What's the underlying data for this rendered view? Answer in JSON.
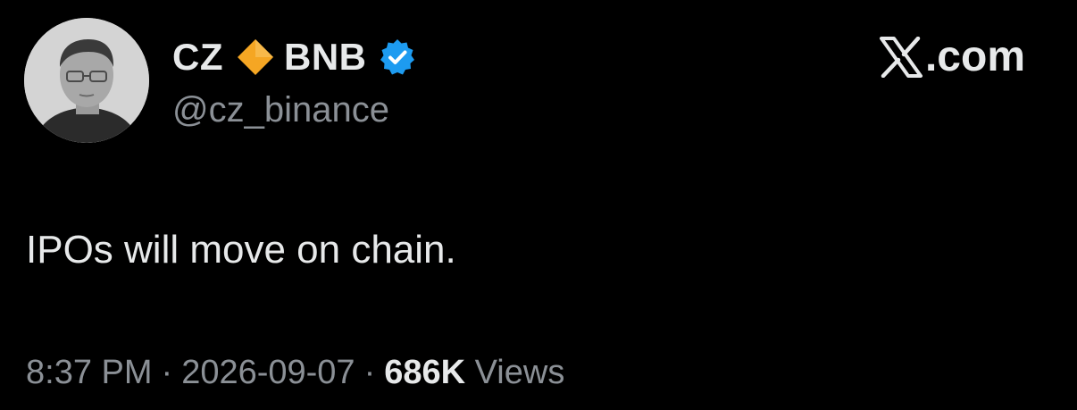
{
  "author": {
    "name_part1": "CZ",
    "name_emoji": "orange-diamond-icon",
    "name_part2": "BNB",
    "verified_badge": "verified-badge-icon",
    "handle": "@cz_binance",
    "avatar": "profile-photo"
  },
  "brand": {
    "logo_icon": "x-logo-icon",
    "label": ".com"
  },
  "tweet": {
    "text": "IPOs will move on chain."
  },
  "meta": {
    "time": "8:37 PM",
    "separator": "·",
    "date": "2026-09-07",
    "views_count": "686K",
    "views_label": "Views"
  },
  "colors": {
    "background": "#000000",
    "primary_text": "#e7e9ea",
    "secondary_text": "#8b9096",
    "verified_blue": "#1d9bf0",
    "diamond_orange": "#f5a623"
  }
}
